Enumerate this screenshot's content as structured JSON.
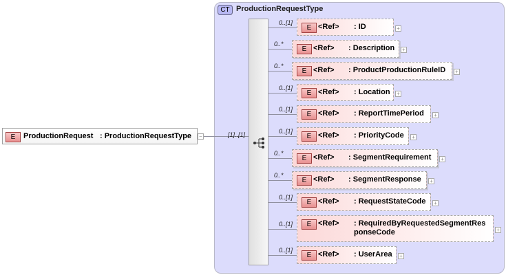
{
  "root": {
    "badge": "E",
    "name": "ProductionRequest",
    "type": ": ProductionRequestType",
    "multiplicity": "[1]..[1]"
  },
  "complex_type": {
    "badge": "CT",
    "title": "ProductionRequestType"
  },
  "children": [
    {
      "mult": "0..[1]",
      "ref": "<Ref>",
      "name": ": ID"
    },
    {
      "mult": "0..*",
      "ref": "<Ref>",
      "name": ": Description"
    },
    {
      "mult": "0..*",
      "ref": "<Ref>",
      "name": ": ProductProductionRuleID"
    },
    {
      "mult": "0..[1]",
      "ref": "<Ref>",
      "name": ": Location"
    },
    {
      "mult": "0..[1]",
      "ref": "<Ref>",
      "name": ": ReportTimePeriod"
    },
    {
      "mult": "0..[1]",
      "ref": "<Ref>",
      "name": ": PriorityCode"
    },
    {
      "mult": "0..*",
      "ref": "<Ref>",
      "name": ": SegmentRequirement"
    },
    {
      "mult": "0..*",
      "ref": "<Ref>",
      "name": ": SegmentResponse"
    },
    {
      "mult": "0..[1]",
      "ref": "<Ref>",
      "name": ": RequestStateCode"
    },
    {
      "mult": "0..[1]",
      "ref": "<Ref>",
      "name": ": RequiredByRequestedSegmentRes\nponseCode"
    },
    {
      "mult": "0..[1]",
      "ref": "<Ref>",
      "name": ": UserArea"
    }
  ],
  "badge_label": "E",
  "plus": "+",
  "minus": "−"
}
